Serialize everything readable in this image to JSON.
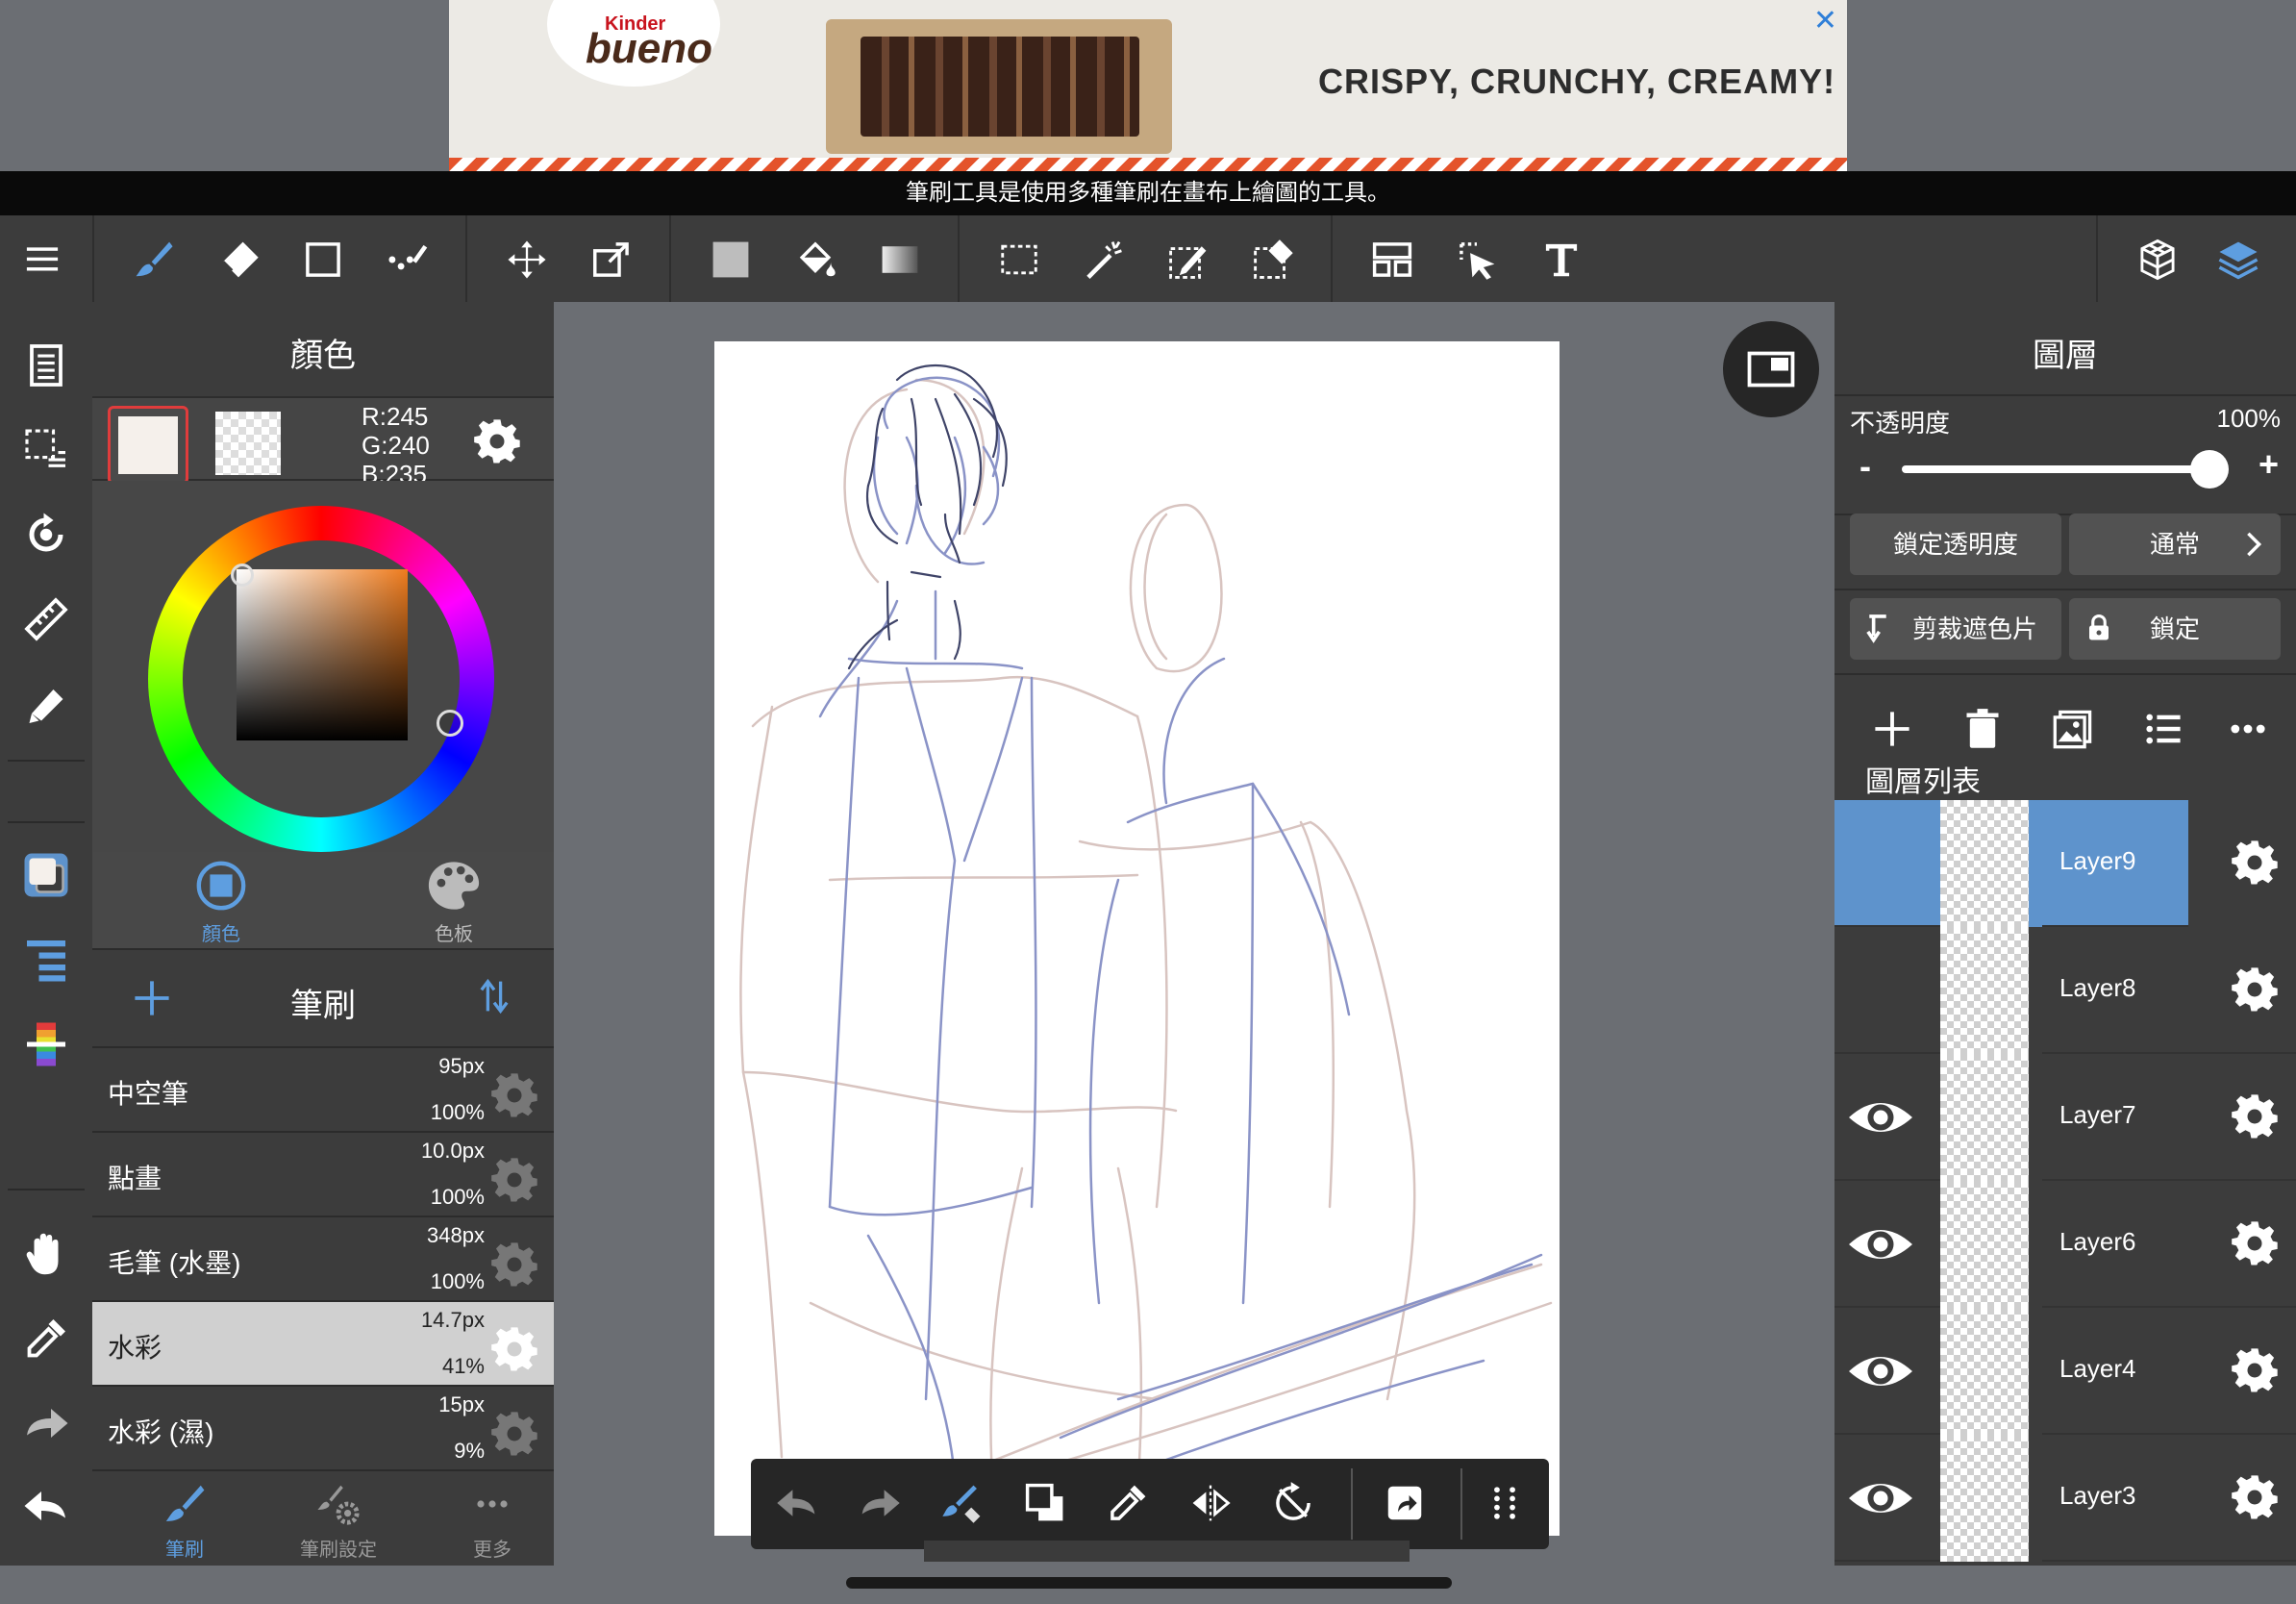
{
  "ad": {
    "logo_top": "Kinder",
    "logo_main": "bueno",
    "tagline": "CRISPY, CRUNCHY, CREAMY!",
    "close_symbol": "✕"
  },
  "infobar": {
    "text": "筆刷工具是使用多種筆刷在畫布上繪圖的工具。"
  },
  "toolbar": {
    "icons": [
      "menu-icon",
      "brush-icon",
      "eraser-icon",
      "rectangle-icon",
      "dotted-stroke-icon",
      "move-icon",
      "transform-icon",
      "fill-color-icon",
      "bucket-icon",
      "gradient-icon",
      "select-icon",
      "magic-wand-icon",
      "select-pen-icon",
      "select-eraser-icon",
      "layer-split-icon",
      "select-pointer-icon",
      "text-icon",
      "3d-cube-icon",
      "layers-icon"
    ]
  },
  "color_panel": {
    "title": "顏色",
    "r": "R:245",
    "g": "G:240",
    "b": "B:235",
    "main_color": "#f5f0eb",
    "tabs": [
      {
        "label": "顏色"
      },
      {
        "label": "色板"
      }
    ]
  },
  "brush_panel": {
    "title": "筆刷",
    "brushes": [
      {
        "name": "中空筆",
        "size": "95px",
        "opacity": "100%",
        "selected": false
      },
      {
        "name": "點畫",
        "size": "10.0px",
        "opacity": "100%",
        "selected": false
      },
      {
        "name": "毛筆 (水墨)",
        "size": "348px",
        "opacity": "100%",
        "selected": false
      },
      {
        "name": "水彩",
        "size": "14.7px",
        "opacity": "41%",
        "selected": true
      },
      {
        "name": "水彩 (濕)",
        "size": "15px",
        "opacity": "9%",
        "selected": false
      }
    ],
    "tabs": [
      {
        "label": "筆刷"
      },
      {
        "label": "筆刷設定"
      },
      {
        "label": "更多"
      }
    ]
  },
  "layer_panel": {
    "title": "圖層",
    "opacity_label": "不透明度",
    "opacity_value": "100%",
    "opacity_fraction": 1.0,
    "minus": "-",
    "plus": "+",
    "lock_alpha": "鎖定透明度",
    "blend_mode": "通常",
    "clipping": "剪裁遮色片",
    "lock": "鎖定",
    "list_title": "圖層列表",
    "layers": [
      {
        "name": "Layer9",
        "visible": false,
        "selected": true
      },
      {
        "name": "Layer8",
        "visible": false,
        "selected": false
      },
      {
        "name": "Layer7",
        "visible": true,
        "selected": false
      },
      {
        "name": "Layer6",
        "visible": true,
        "selected": false
      },
      {
        "name": "Layer4",
        "visible": true,
        "selected": false
      },
      {
        "name": "Layer3",
        "visible": true,
        "selected": false
      }
    ]
  },
  "colors": {
    "accent": "#5e93cc",
    "selected_brush_bg": "#d0d0d0",
    "panel": "#3c3c3c"
  }
}
